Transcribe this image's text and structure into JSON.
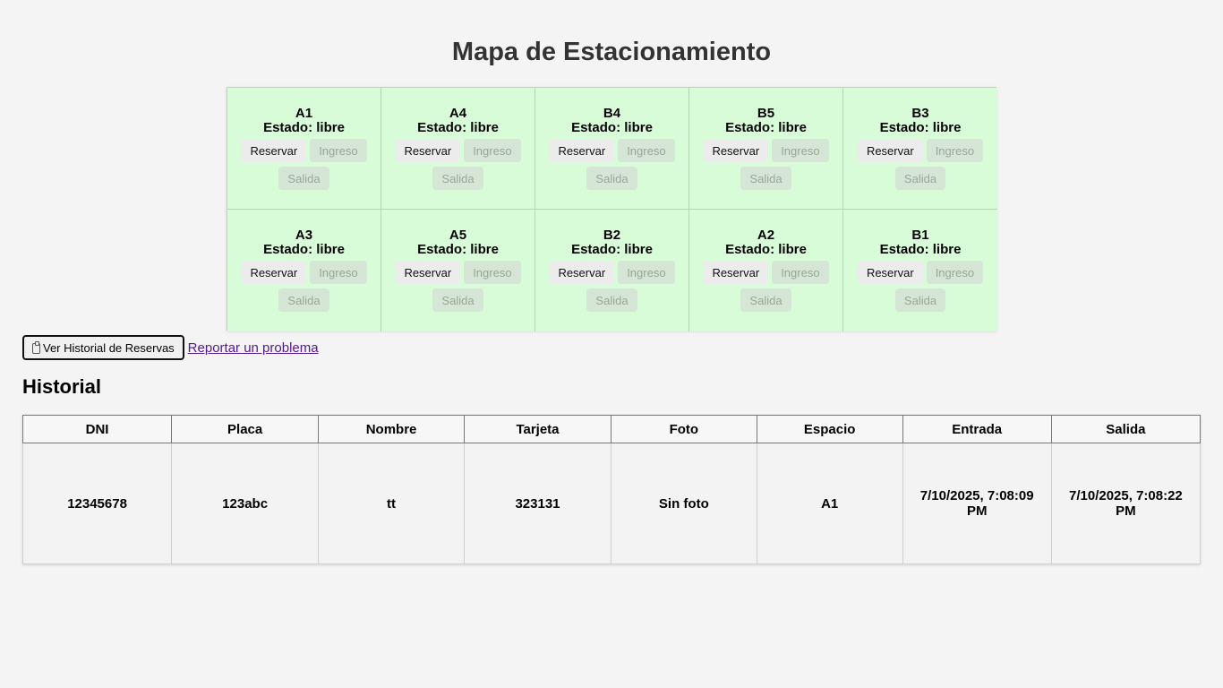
{
  "title": "Mapa de Estacionamiento",
  "spots": [
    {
      "name": "A1",
      "status": "Estado: libre"
    },
    {
      "name": "A4",
      "status": "Estado: libre"
    },
    {
      "name": "B4",
      "status": "Estado: libre"
    },
    {
      "name": "B5",
      "status": "Estado: libre"
    },
    {
      "name": "B3",
      "status": "Estado: libre"
    },
    {
      "name": "A3",
      "status": "Estado: libre"
    },
    {
      "name": "A5",
      "status": "Estado: libre"
    },
    {
      "name": "B2",
      "status": "Estado: libre"
    },
    {
      "name": "A2",
      "status": "Estado: libre"
    },
    {
      "name": "B1",
      "status": "Estado: libre"
    }
  ],
  "buttons": {
    "reserve": "Reservar",
    "entry": "Ingreso",
    "exit": "Salida"
  },
  "actions": {
    "history_button": "Ver Historial de Reservas",
    "history_icon": "clipboard-icon",
    "report_link": "Reportar un problema"
  },
  "history": {
    "title": "Historial",
    "headers": [
      "DNI",
      "Placa",
      "Nombre",
      "Tarjeta",
      "Foto",
      "Espacio",
      "Entrada",
      "Salida"
    ],
    "rows": [
      [
        "12345678",
        "123abc",
        "tt",
        "323131",
        "Sin foto",
        "A1",
        "7/10/2025, 7:08:09 PM",
        "7/10/2025, 7:08:22 PM"
      ]
    ]
  }
}
